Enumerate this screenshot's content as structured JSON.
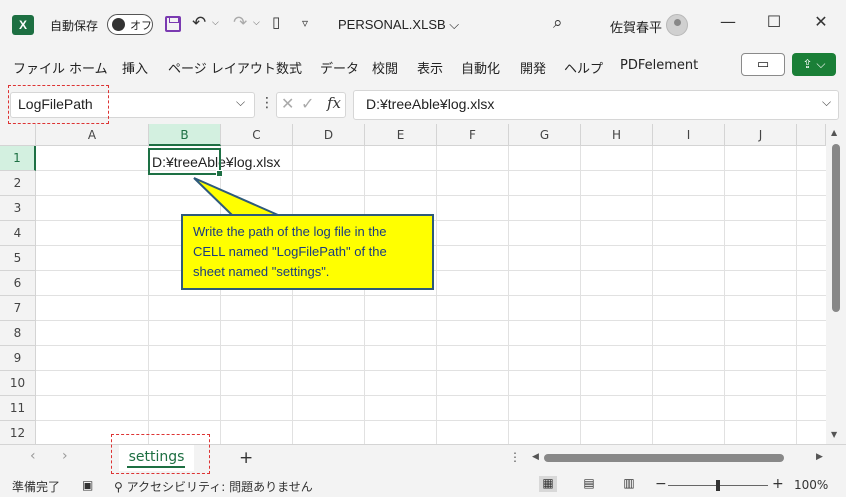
{
  "title_bar": {
    "app_logo": "X",
    "autosave_label": "自動保存",
    "autosave_state": "オフ",
    "filename": "PERSONAL.XLSB",
    "user_name": "佐賀春平",
    "icons": [
      "excel-icon",
      "save-icon",
      "undo-icon",
      "redo-icon",
      "form-icon",
      "customize-icon",
      "search-icon",
      "avatar-icon",
      "minimize-icon",
      "maximize-icon",
      "close-icon"
    ]
  },
  "ribbon": {
    "tabs": [
      "ファイル",
      "ホーム",
      "挿入",
      "ページ レイアウト",
      "数式",
      "データ",
      "校閲",
      "表示",
      "自動化",
      "開発",
      "ヘルプ",
      "PDFelement"
    ]
  },
  "formula_bar": {
    "name_box": "LogFilePath",
    "formula": "D:¥treeAble¥log.xlsx",
    "fx_label": "fx"
  },
  "grid": {
    "columns": [
      "A",
      "B",
      "C",
      "D",
      "E",
      "F",
      "G",
      "H",
      "I",
      "J"
    ],
    "rows": [
      "1",
      "2",
      "3",
      "4",
      "5",
      "6",
      "7",
      "8",
      "9",
      "10",
      "11",
      "12"
    ],
    "active_cell_ref": "B1",
    "cell_b1": "D:¥treeAble¥log.xlsx"
  },
  "callout": {
    "text": "Write the path of the log file in the CELL named \"LogFilePath\" of the sheet named \"settings\".",
    "background": "#ffff00",
    "text_color": "#1a3c80"
  },
  "sheet_tabs": {
    "tabs": [
      "settings"
    ],
    "add_label": "+"
  },
  "status_bar": {
    "ready": "準備完了",
    "accessibility": "アクセシビリティ: 問題ありません",
    "zoom": "100%"
  },
  "colors": {
    "excel_green": "#1d6f42",
    "annotation_red": "#dd3333"
  }
}
